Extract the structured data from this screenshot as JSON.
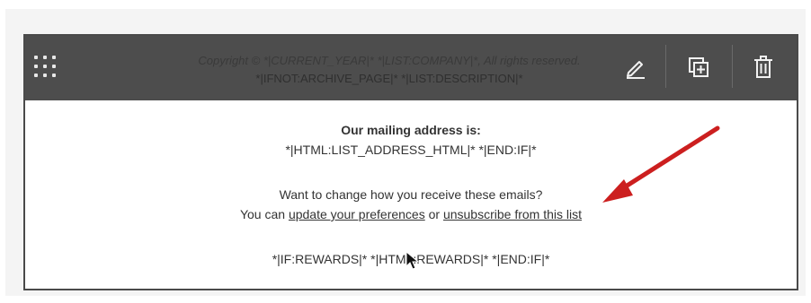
{
  "toolbar": {
    "overlay_line1": "Copyright © *|CURRENT_YEAR|* *|LIST:COMPANY|*, All rights reserved.",
    "overlay_line2": "*|IFNOT:ARCHIVE_PAGE|* *|LIST:DESCRIPTION|*",
    "icons": [
      "drag-handle-icon",
      "edit-pencil-icon",
      "duplicate-icon",
      "trash-icon"
    ]
  },
  "footer": {
    "heading": "Our mailing address is:",
    "address_line": "*|HTML:LIST_ADDRESS_HTML|* *|END:IF|*",
    "question": "Want to change how you receive these emails?",
    "prefix": "You can ",
    "update_link": "update your preferences",
    "middle": " or ",
    "unsubscribe_link": "unsubscribe from this list",
    "rewards_line": "*|IF:REWARDS|* *|HTML:REWARDS|* *|END:IF|*"
  },
  "colors": {
    "toolbar": "#4d4d4d",
    "arrow": "#cc1f1f"
  }
}
